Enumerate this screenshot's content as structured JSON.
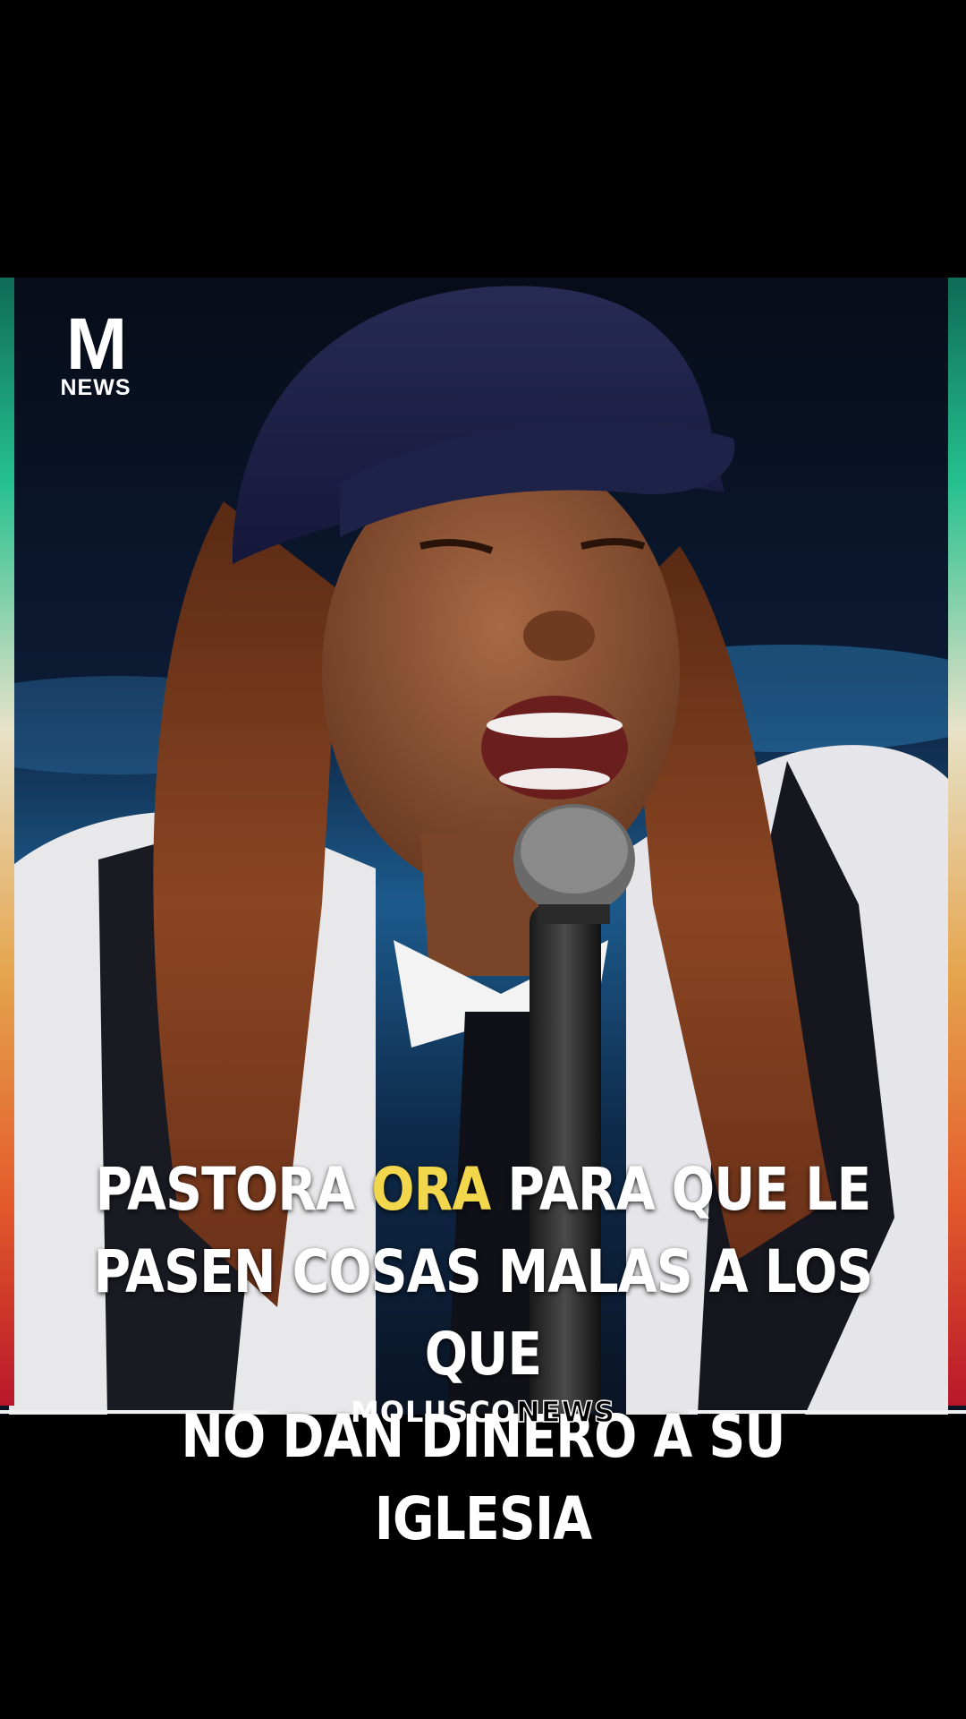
{
  "logo": {
    "mark": "M",
    "sub": "NEWS"
  },
  "headline": {
    "line1_pre": "PASTORA ",
    "line1_accent": "ORA",
    "line1_post": " PARA QUE LE",
    "line2": "PASEN COSAS MALAS A LOS QUE",
    "line3": "NO DAN DINERO A SU IGLESIA"
  },
  "brand": {
    "part1": "MOLUSCO",
    "part2": "NEWS"
  },
  "colors": {
    "accent": "#f2d64b",
    "background": "#000000",
    "text": "#ffffff"
  }
}
